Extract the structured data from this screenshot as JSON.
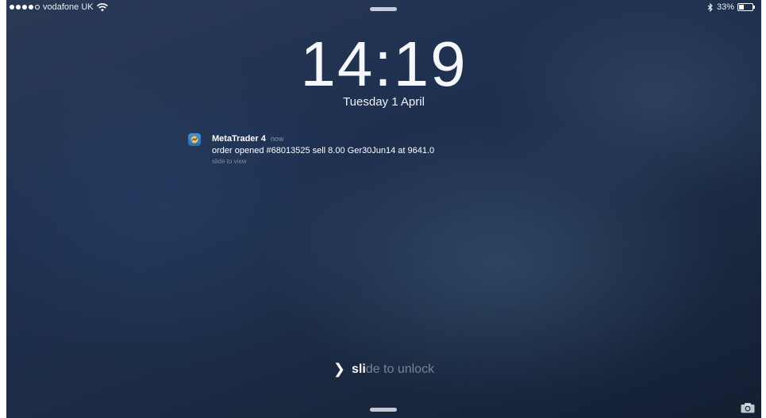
{
  "status_bar": {
    "carrier": "vodafone UK",
    "signal_bars_filled": 4,
    "signal_bars_total": 5,
    "wifi_icon": "wifi-icon",
    "bluetooth_icon": "bluetooth-icon",
    "battery_text": "33%",
    "battery_level": 0.33
  },
  "lock_screen": {
    "time": "14:19",
    "date": "Tuesday 1 April"
  },
  "notification": {
    "app_icon": "metatrader-app-icon",
    "app_name": "MetaTrader 4",
    "time": "now",
    "body": "order opened #68013525 sell 8.00 Ger30Jun14 at 9641.0",
    "hint": "slide to view"
  },
  "unlock": {
    "label_highlight": "sli",
    "label_rest": "de to unlock",
    "chevron_icon": "chevron-right-icon"
  },
  "camera": {
    "icon": "camera-icon"
  }
}
